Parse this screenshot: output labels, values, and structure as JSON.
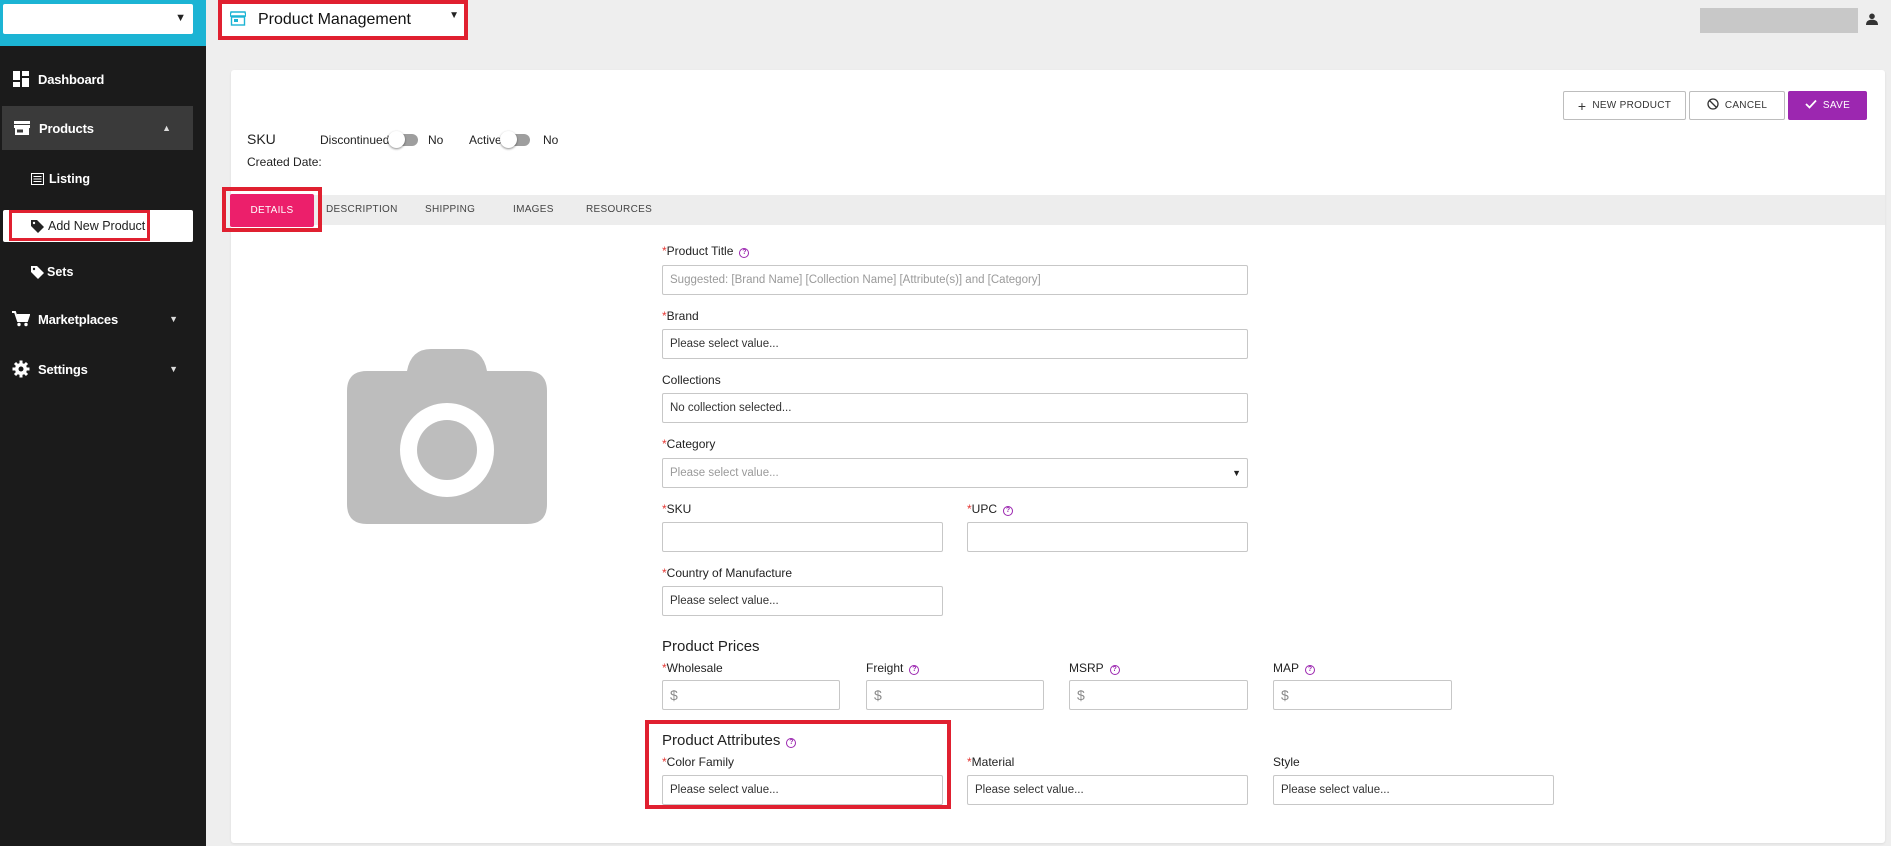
{
  "sidebar": {
    "org_select": "",
    "items": [
      {
        "label": "Dashboard",
        "icon": "dashboard-icon"
      },
      {
        "label": "Products",
        "icon": "store-icon"
      },
      {
        "label": "Marketplaces",
        "icon": "cart-icon"
      },
      {
        "label": "Settings",
        "icon": "gear-icon"
      }
    ],
    "sub_items": [
      {
        "label": "Listing",
        "icon": "list-icon"
      },
      {
        "label": "Add New Product",
        "icon": "tag-icon"
      },
      {
        "label": "Sets",
        "icon": "tag-icon"
      }
    ]
  },
  "header": {
    "app_title": "Product Management",
    "app_icon": "store-icon",
    "user_icon": "person-icon"
  },
  "toolbar": {
    "new_product": "NEW PRODUCT",
    "cancel": "CANCEL",
    "save": "SAVE"
  },
  "product_header": {
    "sku": "SKU",
    "discontinued_label": "Discontinued",
    "discontinued_value": "No",
    "active_label": "Active",
    "active_value": "No",
    "created_date": "Created Date:"
  },
  "tabs": [
    "DETAILS",
    "DESCRIPTION",
    "SHIPPING",
    "IMAGES",
    "RESOURCES"
  ],
  "form": {
    "product_title": {
      "label": "Product Title",
      "placeholder": "Suggested: [Brand Name] [Collection Name] [Attribute(s)] and [Category]"
    },
    "brand": {
      "label": "Brand",
      "value": "Please select value..."
    },
    "collections": {
      "label": "Collections",
      "value": "No collection selected..."
    },
    "category": {
      "label": "Category",
      "value": "Please select value..."
    },
    "sku": {
      "label": "SKU",
      "value": ""
    },
    "upc": {
      "label": "UPC",
      "value": ""
    },
    "country": {
      "label": "Country of Manufacture",
      "value": "Please select value..."
    }
  },
  "prices": {
    "title": "Product Prices",
    "wholesale": "Wholesale",
    "freight": "Freight",
    "msrp": "MSRP",
    "map": "MAP",
    "currency": "$"
  },
  "attributes": {
    "title": "Product Attributes",
    "color_family": {
      "label": "Color Family",
      "value": "Please select value..."
    },
    "material": {
      "label": "Material",
      "value": "Please select value..."
    },
    "style": {
      "label": "Style",
      "value": "Please select value..."
    }
  },
  "colors": {
    "accent_tab": "#ec1f6b",
    "save_button": "#9c27b0",
    "sidebar_bg": "#1b1b1b",
    "sidebar_top": "#1cb4d4",
    "highlight": "#e02030"
  }
}
